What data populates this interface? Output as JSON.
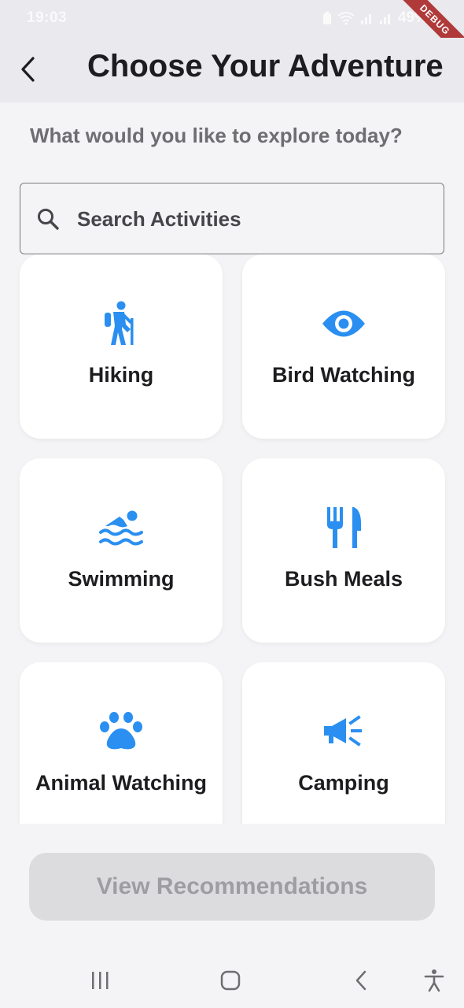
{
  "status_bar": {
    "time": "19:03",
    "battery": "49%"
  },
  "debug_banner": "DEBUG",
  "header": {
    "title": "Choose Your Adventure"
  },
  "subtitle": "What would you like to explore today?",
  "search": {
    "placeholder": "Search Activities",
    "value": ""
  },
  "activities": [
    {
      "label": "Hiking",
      "icon": "hiking-icon"
    },
    {
      "label": "Bird Watching",
      "icon": "eye-icon"
    },
    {
      "label": "Swimming",
      "icon": "swimming-icon"
    },
    {
      "label": "Bush Meals",
      "icon": "restaurant-icon"
    },
    {
      "label": "Animal Watching",
      "icon": "paw-icon"
    },
    {
      "label": "Camping",
      "icon": "campaign-icon"
    }
  ],
  "actions": {
    "view_recommendations": "View Recommendations"
  },
  "colors": {
    "accent": "#2a8ff0",
    "app_bar": "#e9e9ee",
    "background": "#f4f4f6",
    "button_disabled_bg": "#dcdcdf",
    "button_disabled_text": "#9e9ea2"
  },
  "nav_bar": {
    "icons": [
      "recent-apps-icon",
      "home-icon",
      "back-icon",
      "accessibility-icon"
    ]
  }
}
